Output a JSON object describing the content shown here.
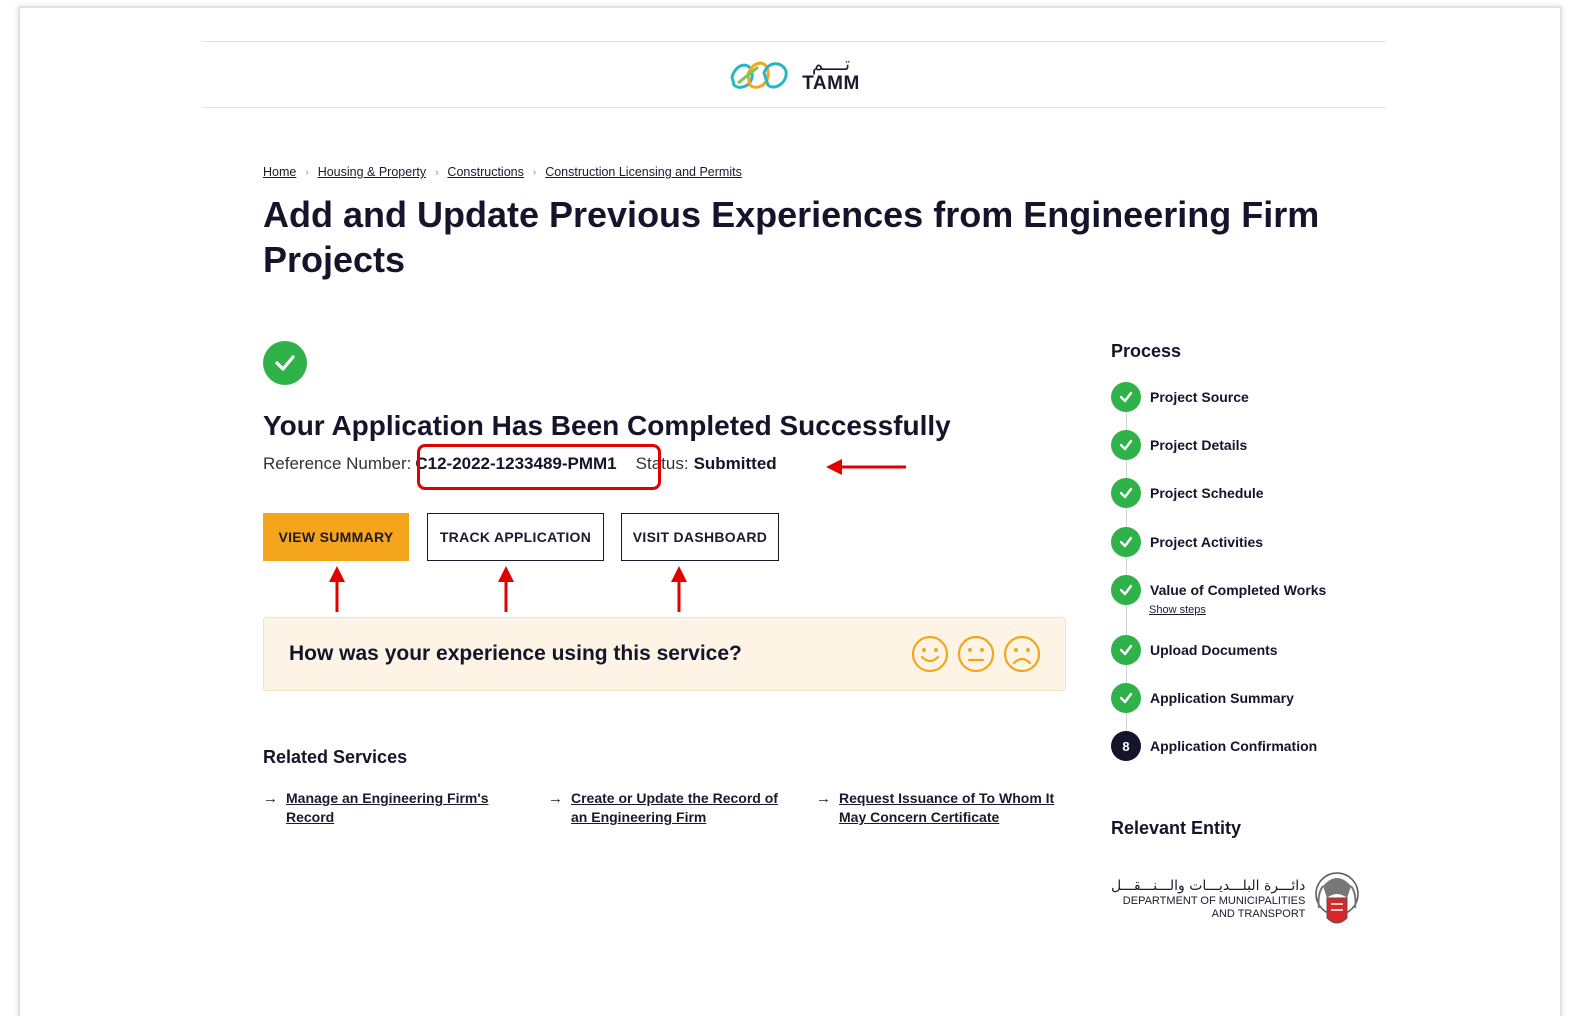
{
  "header": {
    "logo_arabic": "تــــم",
    "logo_latin": "TAMM"
  },
  "breadcrumb": [
    {
      "label": "Home"
    },
    {
      "label": "Housing & Property"
    },
    {
      "label": "Constructions"
    },
    {
      "label": "Construction Licensing and Permits"
    }
  ],
  "page": {
    "title": "Add and Update Previous Experiences from Engineering Firm Projects"
  },
  "confirmation": {
    "title": "Your Application Has Been Completed Successfully",
    "reference_label": "Reference Number:",
    "reference_value": "C12-2022-1233489-PMM1",
    "status_label": "Status:",
    "status_value": "Submitted"
  },
  "actions": {
    "view_summary": "VIEW SUMMARY",
    "track_application": "TRACK APPLICATION",
    "visit_dashboard": "VISIT DASHBOARD"
  },
  "feedback": {
    "question": "How was your experience using this service?"
  },
  "related": {
    "title": "Related Services",
    "links": [
      {
        "line1": "Manage an Engineering Firm's",
        "line2": "Record"
      },
      {
        "line1": "Create or Update the Record of",
        "line2": "an Engineering Firm"
      },
      {
        "line1": "Request Issuance of To Whom It",
        "line2": "May Concern Certificate"
      }
    ]
  },
  "process": {
    "title": "Process",
    "steps": [
      {
        "label": "Project Source",
        "state": "done"
      },
      {
        "label": "Project Details",
        "state": "done"
      },
      {
        "label": "Project Schedule",
        "state": "done"
      },
      {
        "label": "Project Activities",
        "state": "done"
      },
      {
        "label": "Value of Completed Works",
        "state": "done"
      },
      {
        "label": "Upload Documents",
        "state": "done"
      },
      {
        "label": "Application Summary",
        "state": "done"
      },
      {
        "label": "Application Confirmation",
        "state": "current",
        "number": "8"
      }
    ],
    "show_steps": "Show steps"
  },
  "entity": {
    "title": "Relevant Entity",
    "name_arabic": "دائـــرة البلـــديـــات والـــنـــقـــل",
    "name_line1": "DEPARTMENT OF MUNICIPALITIES",
    "name_line2": "AND TRANSPORT"
  },
  "colors": {
    "primary": "#f5a51b",
    "success": "#2fb24a",
    "annotation": "#e00000",
    "text": "#14142b"
  }
}
